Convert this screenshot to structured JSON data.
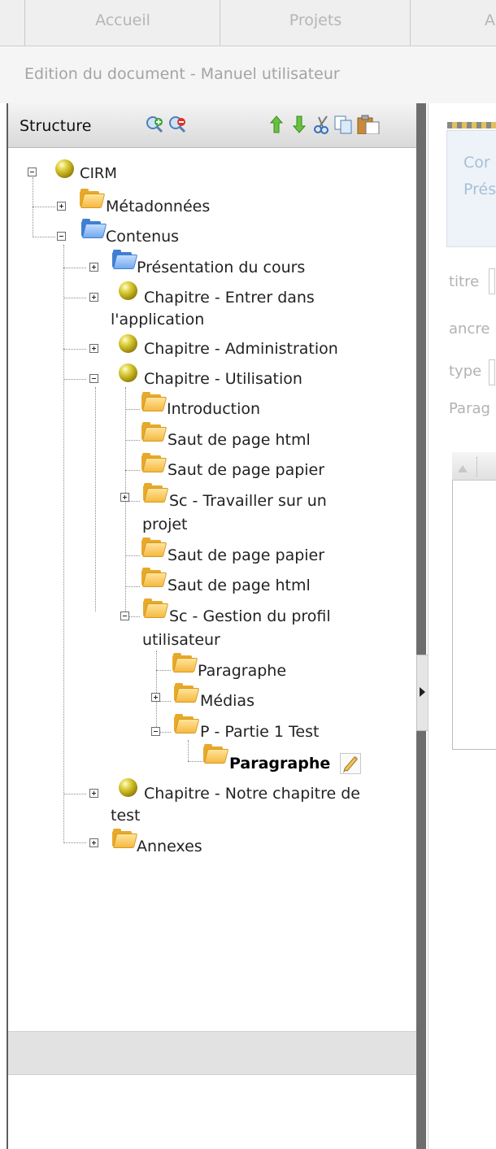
{
  "nav": {
    "tabs": [
      "Accueil",
      "Projets",
      "A"
    ]
  },
  "breadcrumb": "Edition du document - Manuel utilisateur",
  "structure": {
    "title": "Structure",
    "tree": {
      "root": "CIRM",
      "metadonnees": "Métadonnées",
      "contenus": "Contenus",
      "presentation": "Présentation du cours",
      "chap_entrer_1": "Chapitre - Entrer dans",
      "chap_entrer_2": "l'application",
      "chap_admin": "Chapitre - Administration",
      "chap_util": "Chapitre - Utilisation",
      "introduction": "Introduction",
      "saut_html_1": "Saut de page html",
      "saut_papier_1": "Saut de page papier",
      "sc_travailler_1": "Sc - Travailler sur un",
      "sc_travailler_2": "projet",
      "saut_papier_2": "Saut de page papier",
      "saut_html_2": "Saut de page html",
      "sc_gestion_1": "Sc - Gestion du profil",
      "sc_gestion_2": "utilisateur",
      "paragraphe_1": "Paragraphe",
      "medias": "Médias",
      "partie1": "P - Partie 1 Test",
      "paragraphe_sel": "Paragraphe",
      "chap_test_1": "Chapitre - Notre chapitre de",
      "chap_test_2": "test",
      "annexes": "Annexes"
    }
  },
  "right_panel": {
    "link_1": "Cor",
    "link_2": "Prés",
    "titre": "titre",
    "ancre": "ancre",
    "type": "type",
    "parag": "Parag"
  },
  "colors": {
    "folder": "#f6b941",
    "folder_blue": "#74a9ee",
    "link": "#a8bfd6"
  }
}
